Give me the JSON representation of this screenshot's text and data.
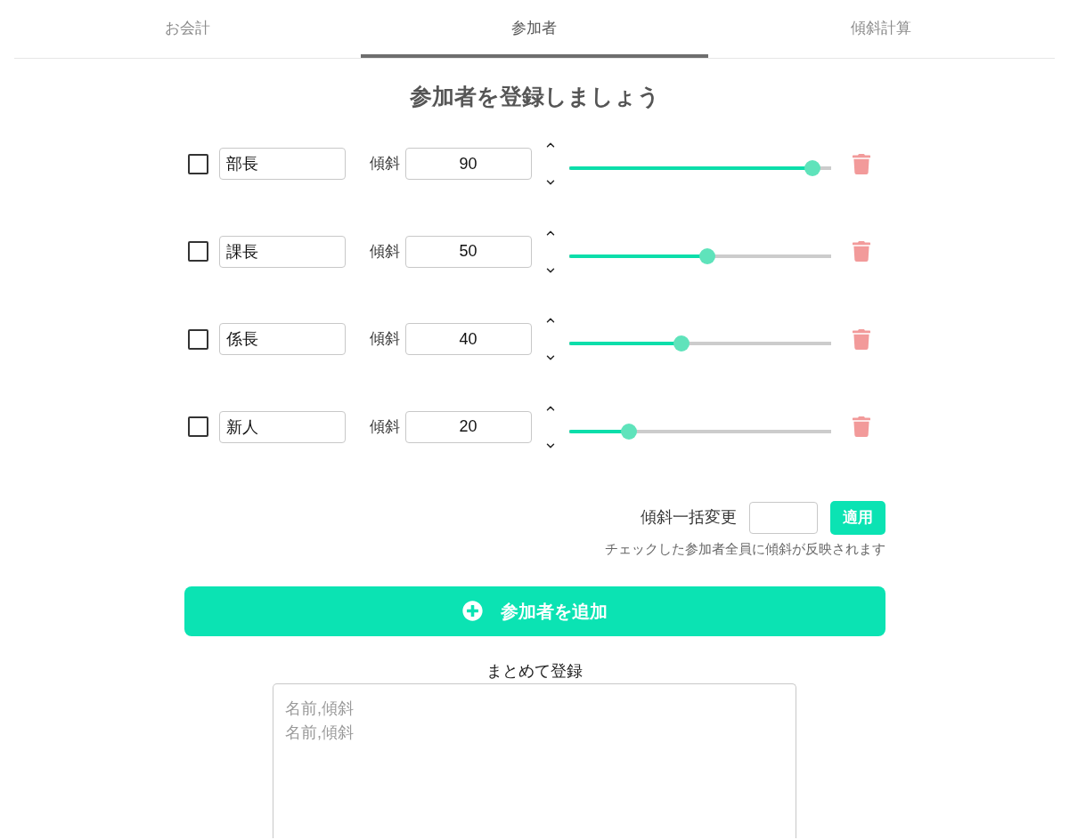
{
  "tabs": [
    {
      "label": "お会計",
      "selected": false
    },
    {
      "label": "参加者",
      "selected": true
    },
    {
      "label": "傾斜計算",
      "selected": false
    }
  ],
  "heading": "参加者を登録しましょう",
  "participants": [
    {
      "checked": false,
      "name": "部長",
      "slope_label": "傾斜",
      "slope": "90",
      "level": 0.93
    },
    {
      "checked": false,
      "name": "課長",
      "slope_label": "傾斜",
      "slope": "50",
      "level": 0.53
    },
    {
      "checked": false,
      "name": "係長",
      "slope_label": "傾斜",
      "slope": "40",
      "level": 0.43
    },
    {
      "checked": false,
      "name": "新人",
      "slope_label": "傾斜",
      "slope": "20",
      "level": 0.23
    }
  ],
  "bulk_change": {
    "label": "傾斜一括変更",
    "button": "適用",
    "hint": "チェックした参加者全員に傾斜が反映されます"
  },
  "add_button": "参加者を追加",
  "bulk_register": {
    "label": "まとめて登録",
    "placeholder": [
      "名前,傾斜",
      "名前,傾斜"
    ]
  }
}
